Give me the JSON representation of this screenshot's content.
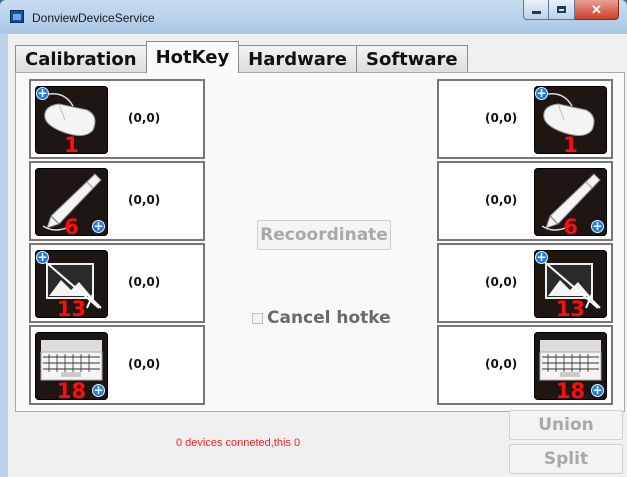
{
  "window": {
    "title": "DonviewDeviceService"
  },
  "tabs": [
    {
      "label": "Calibration",
      "active": false
    },
    {
      "label": "HotKey",
      "active": true
    },
    {
      "label": "Hardware",
      "active": false
    },
    {
      "label": "Software",
      "active": false
    }
  ],
  "left_slots": [
    {
      "icon": "mouse-icon",
      "number": "1",
      "coord": "(0,0)",
      "badge": "top-left"
    },
    {
      "icon": "pen-icon",
      "number": "6",
      "coord": "(0,0)",
      "badge": "bottom-right"
    },
    {
      "icon": "screen-capture-icon",
      "number": "13",
      "coord": "(0,0)",
      "badge": "top-left"
    },
    {
      "icon": "keyboard-icon",
      "number": "18",
      "coord": "(0,0)",
      "badge": "bottom-right"
    }
  ],
  "right_slots": [
    {
      "icon": "mouse-icon",
      "number": "1",
      "coord": "(0,0)",
      "badge": "top-left"
    },
    {
      "icon": "pen-icon",
      "number": "6",
      "coord": "(0,0)",
      "badge": "bottom-right"
    },
    {
      "icon": "screen-capture-icon",
      "number": "13",
      "coord": "(0,0)",
      "badge": "top-left"
    },
    {
      "icon": "keyboard-icon",
      "number": "18",
      "coord": "(0,0)",
      "badge": "bottom-right"
    }
  ],
  "controls": {
    "recoordinate_label": "Recoordinate",
    "cancel_hotkey_label": "Cancel hotke",
    "cancel_hotkey_checked": false
  },
  "status": {
    "text": "0 devices conneted,this 0",
    "color": "#ff2020"
  },
  "buttons": {
    "union": "Union",
    "split": "Split"
  },
  "colors": {
    "accent_number": "#ff0d0d",
    "badge": "#1e7de0",
    "disabled_text": "#a9a9a9"
  }
}
